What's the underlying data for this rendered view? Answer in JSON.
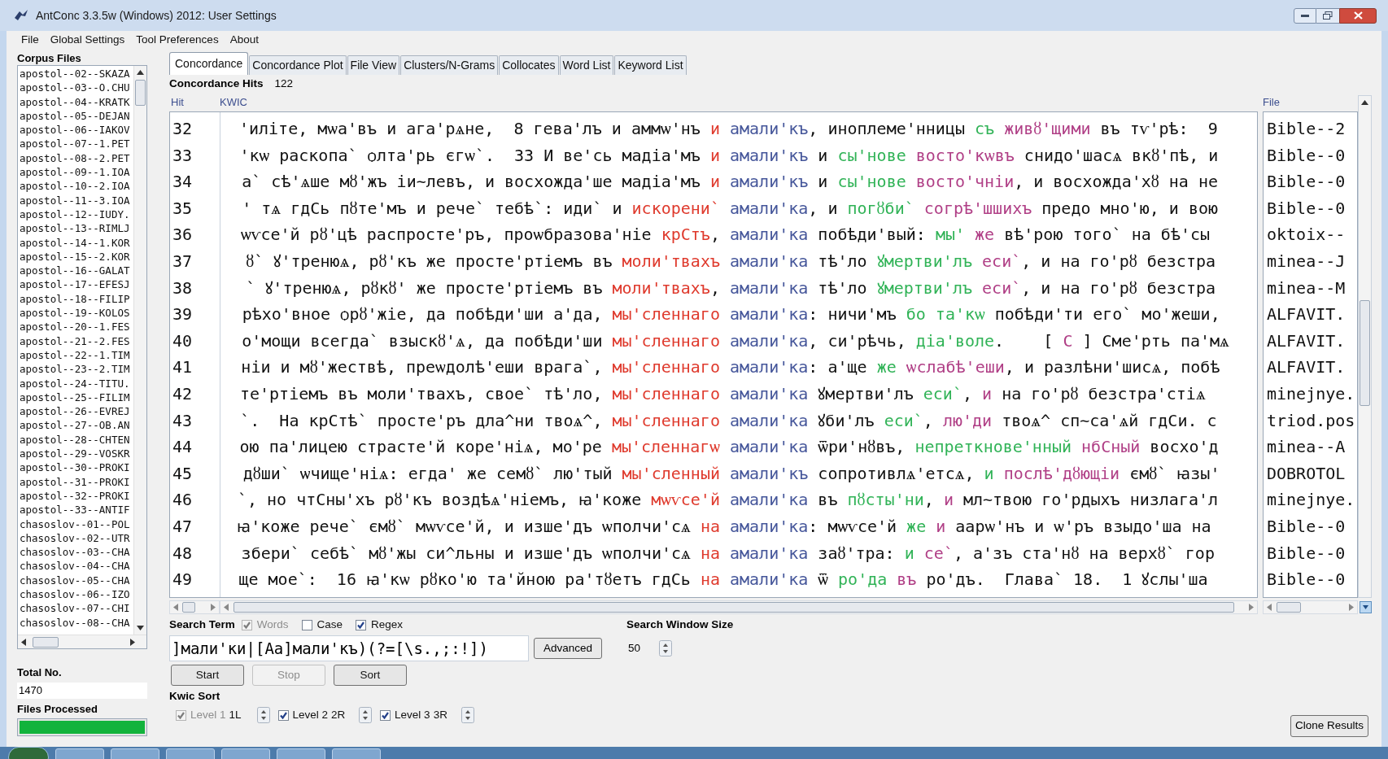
{
  "window": {
    "title": "AntConc 3.3.5w (Windows) 2012: User Settings"
  },
  "menu": [
    "File",
    "Global Settings",
    "Tool Preferences",
    "About"
  ],
  "corpus_panel": {
    "heading": "Corpus Files",
    "files": [
      "apostol--02--SKAZA",
      "apostol--03--O.CHU",
      "apostol--04--KRATK",
      "apostol--05--DEJAN",
      "apostol--06--IAKOV",
      "apostol--07--1.PET",
      "apostol--08--2.PET",
      "apostol--09--1.IOA",
      "apostol--10--2.IOA",
      "apostol--11--3.IOA",
      "apostol--12--IUDY.",
      "apostol--13--RIMLJ",
      "apostol--14--1.KOR",
      "apostol--15--2.KOR",
      "apostol--16--GALAT",
      "apostol--17--EFESJ",
      "apostol--18--FILIP",
      "apostol--19--KOLOS",
      "apostol--20--1.FES",
      "apostol--21--2.FES",
      "apostol--22--1.TIM",
      "apostol--23--2.TIM",
      "apostol--24--TITU.",
      "apostol--25--FILIM",
      "apostol--26--EVREJ",
      "apostol--27--OB.AN",
      "apostol--28--CHTEN",
      "apostol--29--VOSKR",
      "apostol--30--PROKI",
      "apostol--31--PROKI",
      "apostol--32--PROKI",
      "apostol--33--ANTIF",
      "chasoslov--01--POL",
      "chasoslov--02--UTR",
      "chasoslov--03--CHA",
      "chasoslov--04--CHA",
      "chasoslov--05--CHA",
      "chasoslov--06--IZO",
      "chasoslov--07--CHI",
      "chasoslov--08--CHA"
    ],
    "total_label": "Total No.",
    "total_value": "1470",
    "processed_label": "Files Processed",
    "progress": {
      "level": 1
    }
  },
  "tabs": [
    {
      "label": "Concordance",
      "selected": true
    },
    {
      "label": "Concordance Plot",
      "selected": false
    },
    {
      "label": "File View",
      "selected": false
    },
    {
      "label": "Clusters/N-Grams",
      "selected": false
    },
    {
      "label": "Collocates",
      "selected": false
    },
    {
      "label": "Word List",
      "selected": false
    },
    {
      "label": "Keyword List",
      "selected": false
    }
  ],
  "hits": {
    "label": "Concordance Hits",
    "value": "122"
  },
  "table": {
    "columns": [
      "Hit",
      "KWIC",
      "File"
    ],
    "rows": [
      {
        "hit": "32",
        "file": "Bible--2",
        "segments": [
          {
            "kind": "context",
            "text": "'иліте, мѡа'въ и ага'рѧне,  8 гева'лъ и аммѡ'нъ "
          },
          {
            "kind": "sort_1",
            "text": "и "
          },
          {
            "kind": "keyword",
            "text": "амали'къ"
          },
          {
            "kind": "context",
            "text": ", иноплеме'нницы "
          },
          {
            "kind": "sort_2",
            "text": "съ "
          },
          {
            "kind": "sort_3",
            "text": "живȣ'щими"
          },
          {
            "kind": "context",
            "text": " въ тѵ'рѣ:  9"
          }
        ]
      },
      {
        "hit": "33",
        "file": "Bible--0",
        "segments": [
          {
            "kind": "context",
            "text": "'кѡ раскопа` ѻлта'рь єгѡ`.  33 И ве'сь мадіа'мъ "
          },
          {
            "kind": "sort_1",
            "text": "и "
          },
          {
            "kind": "keyword",
            "text": "амали'къ"
          },
          {
            "kind": "context",
            "text": " и "
          },
          {
            "kind": "sort_2",
            "text": "сы'нове "
          },
          {
            "kind": "sort_3",
            "text": "восто'кѡвъ"
          },
          {
            "kind": "context",
            "text": " снидо'шасѧ вкȣ'пѣ, и"
          }
        ]
      },
      {
        "hit": "34",
        "file": "Bible--0",
        "segments": [
          {
            "kind": "context",
            "text": "а` сѣ'ѧше мȣ'жъ іи~левъ, и восхожда'ше мадіа'мъ "
          },
          {
            "kind": "sort_1",
            "text": "и "
          },
          {
            "kind": "keyword",
            "text": "амали'къ"
          },
          {
            "kind": "context",
            "text": " и "
          },
          {
            "kind": "sort_2",
            "text": "сы'нове "
          },
          {
            "kind": "sort_3",
            "text": "восто'чніи"
          },
          {
            "kind": "context",
            "text": ", и восхожда'хȣ на не"
          }
        ]
      },
      {
        "hit": "35",
        "file": "Bible--0",
        "segments": [
          {
            "kind": "context",
            "text": "' тѧ гдСь пȣте'мъ и рече` тебѣ`: иди` и "
          },
          {
            "kind": "sort_1",
            "text": "искорени` "
          },
          {
            "kind": "keyword",
            "text": "амали'ка"
          },
          {
            "kind": "context",
            "text": ", и "
          },
          {
            "kind": "sort_2",
            "text": "погȣби` "
          },
          {
            "kind": "sort_3",
            "text": "согрѣ'шшихъ"
          },
          {
            "kind": "context",
            "text": " предо мно'ю, и вою"
          }
        ]
      },
      {
        "hit": "36",
        "file": "oktoix--",
        "segments": [
          {
            "kind": "context",
            "text": "ѡѵсе'й рȣ'цѣ распросте'ръ, проѡбразова'ніе "
          },
          {
            "kind": "sort_1",
            "text": "крСтъ"
          },
          {
            "kind": "context",
            "text": ", "
          },
          {
            "kind": "keyword",
            "text": "амали'ка"
          },
          {
            "kind": "context",
            "text": " побѣди'вый: "
          },
          {
            "kind": "sort_2",
            "text": "мы' "
          },
          {
            "kind": "sort_3",
            "text": "же"
          },
          {
            "kind": "context",
            "text": " вѣ'рою того` на бѣ'сы"
          }
        ]
      },
      {
        "hit": "37",
        "file": "minea--J",
        "segments": [
          {
            "kind": "context",
            "text": "ȣ` ꙋ'тренюѧ, рȣ'къ же просте'ртіемъ въ "
          },
          {
            "kind": "sort_1",
            "text": "моли'твахъ "
          },
          {
            "kind": "keyword",
            "text": "амали'ка"
          },
          {
            "kind": "context",
            "text": " тѣ'ло "
          },
          {
            "kind": "sort_2",
            "text": "ꙋмертви'лъ "
          },
          {
            "kind": "sort_3",
            "text": "еси`"
          },
          {
            "kind": "context",
            "text": ", и на го'рȣ безстра"
          }
        ]
      },
      {
        "hit": "38",
        "file": "minea--M",
        "segments": [
          {
            "kind": "context",
            "text": "` ꙋ'тренюѧ, рȣкȣ' же просте'ртіемъ въ "
          },
          {
            "kind": "sort_1",
            "text": "моли'твахъ"
          },
          {
            "kind": "context",
            "text": ", "
          },
          {
            "kind": "keyword",
            "text": "амали'ка"
          },
          {
            "kind": "context",
            "text": " тѣ'ло "
          },
          {
            "kind": "sort_2",
            "text": "ꙋмертви'лъ "
          },
          {
            "kind": "sort_3",
            "text": "еси`"
          },
          {
            "kind": "context",
            "text": ", и на го'рȣ безстра"
          }
        ]
      },
      {
        "hit": "39",
        "file": "ALFAVIT.",
        "segments": [
          {
            "kind": "context",
            "text": "рѣхо'вное ѻрȣ'жіе, да побѣди'ши а'да, "
          },
          {
            "kind": "sort_1",
            "text": "мы'сленнаго "
          },
          {
            "kind": "keyword",
            "text": "амали'ка"
          },
          {
            "kind": "context",
            "text": ": ничи'мъ "
          },
          {
            "kind": "sort_2",
            "text": "бо та'кѡ"
          },
          {
            "kind": "context",
            "text": " побѣди'ти его` мо'жеши,"
          }
        ]
      },
      {
        "hit": "40",
        "file": "ALFAVIT.",
        "segments": [
          {
            "kind": "context",
            "text": "о'мощи всегда` взыскȣ'ѧ, да побѣди'ши "
          },
          {
            "kind": "sort_1",
            "text": "мы'сленнаго "
          },
          {
            "kind": "keyword",
            "text": "амали'ка"
          },
          {
            "kind": "context",
            "text": ", си'рѣчь, "
          },
          {
            "kind": "sort_2",
            "text": "діа'воле"
          },
          {
            "kind": "context",
            "text": ".    [ "
          },
          {
            "kind": "sort_3",
            "text": "С"
          },
          {
            "kind": "context",
            "text": " ] Сме'рть па'мѧ"
          }
        ]
      },
      {
        "hit": "41",
        "file": "ALFAVIT.",
        "segments": [
          {
            "kind": "context",
            "text": "ніи и мȣ'жествѣ, преѡдолѣ'еши врага`, "
          },
          {
            "kind": "sort_1",
            "text": "мы'сленнаго "
          },
          {
            "kind": "keyword",
            "text": "амали'ка"
          },
          {
            "kind": "context",
            "text": ": а'ще "
          },
          {
            "kind": "sort_2",
            "text": "же "
          },
          {
            "kind": "sort_3",
            "text": "ѡслабѣ'еши"
          },
          {
            "kind": "context",
            "text": ", и разлѣни'шисѧ, побѣ"
          }
        ]
      },
      {
        "hit": "42",
        "file": "minejnye.",
        "segments": [
          {
            "kind": "context",
            "text": "те'ртіемъ въ моли'твахъ, свое` тѣ'ло, "
          },
          {
            "kind": "sort_1",
            "text": "мы'сленнаго "
          },
          {
            "kind": "keyword",
            "text": "амали'ка"
          },
          {
            "kind": "context",
            "text": " ꙋмертви'лъ "
          },
          {
            "kind": "sort_2",
            "text": "еси`"
          },
          {
            "kind": "context",
            "text": ", "
          },
          {
            "kind": "sort_3",
            "text": "и"
          },
          {
            "kind": "context",
            "text": " на го'рȣ безстра'стіѧ"
          }
        ]
      },
      {
        "hit": "43",
        "file": "triod.pos",
        "segments": [
          {
            "kind": "context",
            "text": "`.  На крСтѣ` просте'ръ дла^ни твоѧ^, "
          },
          {
            "kind": "sort_1",
            "text": "мы'сленнаго "
          },
          {
            "kind": "keyword",
            "text": "амали'ка"
          },
          {
            "kind": "context",
            "text": " ꙋби'лъ "
          },
          {
            "kind": "sort_2",
            "text": "еси`"
          },
          {
            "kind": "context",
            "text": ", "
          },
          {
            "kind": "sort_3",
            "text": "лю'ди"
          },
          {
            "kind": "context",
            "text": " твоѧ^ сп~са'ѧй гдСи. с"
          }
        ]
      },
      {
        "hit": "44",
        "file": "minea--A",
        "segments": [
          {
            "kind": "context",
            "text": "ою па'лицею страсте'й коре'ніѧ, мо'ре "
          },
          {
            "kind": "sort_1",
            "text": "мы'сленнагѡ "
          },
          {
            "kind": "keyword",
            "text": "амали'ка"
          },
          {
            "kind": "context",
            "text": " ѿри'нȣвъ, "
          },
          {
            "kind": "sort_2",
            "text": "непреткнове'нный "
          },
          {
            "kind": "sort_3",
            "text": "нбСный"
          },
          {
            "kind": "context",
            "text": " восхо'д"
          }
        ]
      },
      {
        "hit": "45",
        "file": "DOBROTOL",
        "segments": [
          {
            "kind": "context",
            "text": "дȣши` ѡчище'ніѧ: егда' же семȣ` лю'тый "
          },
          {
            "kind": "sort_1",
            "text": "мы'сленный "
          },
          {
            "kind": "keyword",
            "text": "амали'къ"
          },
          {
            "kind": "context",
            "text": " сопротивлѧ'етсѧ, "
          },
          {
            "kind": "sort_2",
            "text": "и "
          },
          {
            "kind": "sort_3",
            "text": "послѣ'дȣющіи"
          },
          {
            "kind": "context",
            "text": " ємȣ` ꙗзы'"
          }
        ]
      },
      {
        "hit": "46",
        "file": "minejnye.",
        "segments": [
          {
            "kind": "context",
            "text": "`, но чтСны'хъ рȣ'къ воздѣѧ'ніемъ, ꙗ'коже "
          },
          {
            "kind": "sort_1",
            "text": "мѡѵсе'й "
          },
          {
            "kind": "keyword",
            "text": "амали'ка"
          },
          {
            "kind": "context",
            "text": " въ "
          },
          {
            "kind": "sort_2",
            "text": "пȣсты'ни"
          },
          {
            "kind": "context",
            "text": ", "
          },
          {
            "kind": "sort_3",
            "text": "и"
          },
          {
            "kind": "context",
            "text": " мл~твою го'рдыхъ низлага'л"
          }
        ]
      },
      {
        "hit": "47",
        "file": "Bible--0",
        "segments": [
          {
            "kind": "context",
            "text": "ꙗ'коже рече` ємȣ` мѡѵсе'й, и изше'дъ ѡполчи'сѧ "
          },
          {
            "kind": "sort_1",
            "text": "на "
          },
          {
            "kind": "keyword",
            "text": "амали'ка"
          },
          {
            "kind": "context",
            "text": ": мѡѵсе'й "
          },
          {
            "kind": "sort_2",
            "text": "же "
          },
          {
            "kind": "sort_3",
            "text": "и"
          },
          {
            "kind": "context",
            "text": " аарѡ'нъ и ѡ'ръ взыдо'ша на"
          }
        ]
      },
      {
        "hit": "48",
        "file": "Bible--0",
        "segments": [
          {
            "kind": "context",
            "text": "збери` себѣ` мȣ'жы си^льны и изше'дъ ѡполчи'сѧ "
          },
          {
            "kind": "sort_1",
            "text": "на "
          },
          {
            "kind": "keyword",
            "text": "амали'ка"
          },
          {
            "kind": "context",
            "text": " заȣ'тра: "
          },
          {
            "kind": "sort_2",
            "text": "и "
          },
          {
            "kind": "sort_3",
            "text": "се`"
          },
          {
            "kind": "context",
            "text": ", а'зъ ста'нȣ на верхȣ` гор"
          }
        ]
      },
      {
        "hit": "49",
        "file": "Bible--0",
        "segments": [
          {
            "kind": "context",
            "text": "ще мое`:  16 ꙗ'кѡ рȣко'ю та'йною ра'тȣетъ гдСь "
          },
          {
            "kind": "sort_1",
            "text": "на "
          },
          {
            "kind": "keyword",
            "text": "амали'ка"
          },
          {
            "kind": "context",
            "text": " ѿ "
          },
          {
            "kind": "sort_2",
            "text": "ро'да "
          },
          {
            "kind": "sort_3",
            "text": "въ"
          },
          {
            "kind": "context",
            "text": " ро'дъ.  Глава` 18.  1 ꙋслы'ша"
          }
        ]
      }
    ]
  },
  "search": {
    "label": "Search Term",
    "options": [
      {
        "label": "Words",
        "checked": true,
        "disabled": true
      },
      {
        "label": "Case",
        "checked": false,
        "disabled": false
      },
      {
        "label": "Regex",
        "checked": true,
        "disabled": false
      }
    ],
    "query": "]мали'ки|[Аа]мали'къ)(?=[\\s.,;:!])",
    "advanced": "Advanced",
    "window_size_label": "Search Window Size",
    "window_size": "50"
  },
  "buttons": [
    {
      "label": "Start",
      "disabled": false
    },
    {
      "label": "Stop",
      "disabled": true
    },
    {
      "label": "Sort",
      "disabled": false
    }
  ],
  "kwic_sort": {
    "label": "Kwic Sort",
    "levels": [
      {
        "label": "Level 1",
        "value": "1L",
        "checked": true,
        "disabled": true
      },
      {
        "label": "Level 2",
        "value": "2R",
        "checked": true,
        "disabled": false
      },
      {
        "label": "Level 3",
        "value": "3R",
        "checked": true,
        "disabled": false
      }
    ]
  },
  "clone_button": "Clone Results"
}
